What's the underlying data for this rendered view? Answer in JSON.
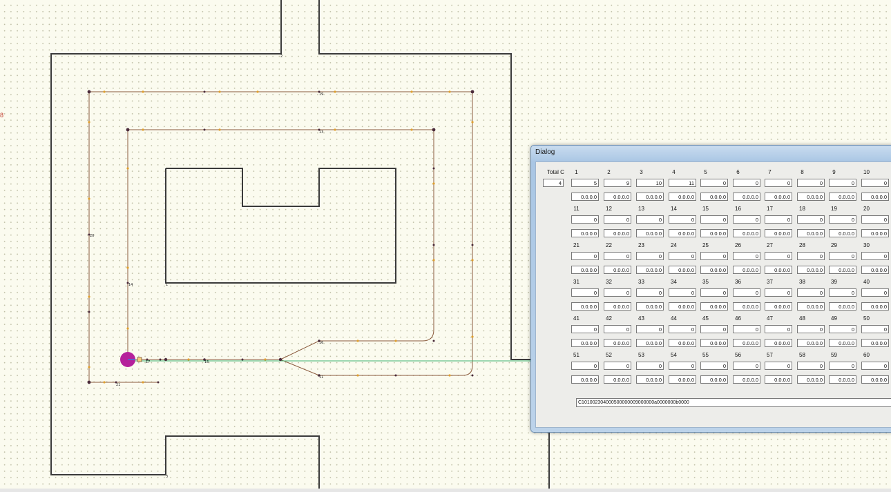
{
  "dialog": {
    "title": "Dialog",
    "total_label": "Total C",
    "total_value": "4",
    "rows": [
      {
        "headers": [
          "1",
          "2",
          "3",
          "4",
          "5",
          "6",
          "7",
          "8",
          "9",
          "10"
        ],
        "values": [
          "5",
          "9",
          "10",
          "11",
          "0",
          "0",
          "0",
          "0",
          "0",
          "0"
        ],
        "ips": [
          "0.0.0.0",
          "0.0.0.0",
          "0.0.0.0",
          "0.0.0.0",
          "0.0.0.0",
          "0.0.0.0",
          "0.0.0.0",
          "0.0.0.0",
          "0.0.0.0",
          "0.0.0.0"
        ]
      },
      {
        "headers": [
          "11",
          "12",
          "13",
          "14",
          "15",
          "16",
          "17",
          "18",
          "19",
          "20"
        ],
        "values": [
          "0",
          "0",
          "0",
          "0",
          "0",
          "0",
          "0",
          "0",
          "0",
          "0"
        ],
        "ips": [
          "0.0.0.0",
          "0.0.0.0",
          "0.0.0.0",
          "0.0.0.0",
          "0.0.0.0",
          "0.0.0.0",
          "0.0.0.0",
          "0.0.0.0",
          "0.0.0.0",
          "0.0.0.0"
        ]
      },
      {
        "headers": [
          "21",
          "22",
          "23",
          "24",
          "25",
          "26",
          "27",
          "28",
          "29",
          "30"
        ],
        "values": [
          "0",
          "0",
          "0",
          "0",
          "0",
          "0",
          "0",
          "0",
          "0",
          "0"
        ],
        "ips": [
          "0.0.0.0",
          "0.0.0.0",
          "0.0.0.0",
          "0.0.0.0",
          "0.0.0.0",
          "0.0.0.0",
          "0.0.0.0",
          "0.0.0.0",
          "0.0.0.0",
          "0.0.0.0"
        ]
      },
      {
        "headers": [
          "31",
          "32",
          "33",
          "34",
          "35",
          "36",
          "37",
          "38",
          "39",
          "40"
        ],
        "values": [
          "0",
          "0",
          "0",
          "0",
          "0",
          "0",
          "0",
          "0",
          "0",
          "0"
        ],
        "ips": [
          "0.0.0.0",
          "0.0.0.0",
          "0.0.0.0",
          "0.0.0.0",
          "0.0.0.0",
          "0.0.0.0",
          "0.0.0.0",
          "0.0.0.0",
          "0.0.0.0",
          "0.0.0.0"
        ]
      },
      {
        "headers": [
          "41",
          "42",
          "43",
          "44",
          "45",
          "46",
          "47",
          "48",
          "49",
          "50"
        ],
        "values": [
          "0",
          "0",
          "0",
          "0",
          "0",
          "0",
          "0",
          "0",
          "0",
          "0"
        ],
        "ips": [
          "0.0.0.0",
          "0.0.0.0",
          "0.0.0.0",
          "0.0.0.0",
          "0.0.0.0",
          "0.0.0.0",
          "0.0.0.0",
          "0.0.0.0",
          "0.0.0.0",
          "0.0.0.0"
        ]
      },
      {
        "headers": [
          "51",
          "52",
          "53",
          "54",
          "55",
          "56",
          "57",
          "58",
          "59",
          "60"
        ],
        "values": [
          "0",
          "0",
          "0",
          "0",
          "0",
          "0",
          "0",
          "0",
          "0",
          "0"
        ],
        "ips": [
          "0.0.0.0",
          "0.0.0.0",
          "0.0.0.0",
          "0.0.0.0",
          "0.0.0.0",
          "0.0.0.0",
          "0.0.0.0",
          "0.0.0.0",
          "0.0.0.0",
          "0.0.0.0"
        ]
      }
    ],
    "status_string": "C101002304000500000009000000a0000000b0000"
  },
  "map": {
    "side_marker": "8",
    "node_labels": [
      "19",
      "13",
      "20",
      "14",
      "16",
      "11",
      "21",
      "15",
      "17",
      "12",
      "2",
      "1",
      "3"
    ]
  },
  "colors": {
    "wall": "#3a3a3a",
    "path_brown": "#7a4f3a",
    "path_orange": "#e0a030",
    "node": "#4a2a3a",
    "robot": "#b5219b",
    "laser": "#3cb371"
  }
}
